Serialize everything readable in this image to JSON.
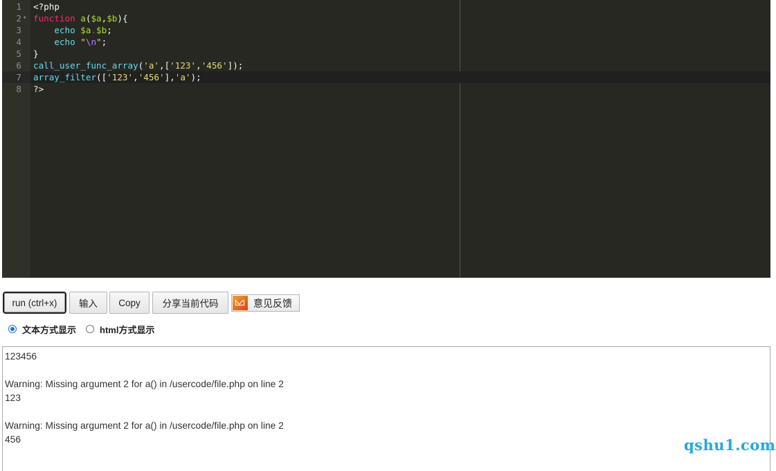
{
  "editor": {
    "line_numbers": [
      "1",
      "2",
      "3",
      "4",
      "5",
      "6",
      "7",
      "8"
    ],
    "fold_marker": "▾",
    "lines": {
      "l1": {
        "open": "<?php"
      },
      "l2": {
        "kw": "function",
        "fname": " a",
        "p1": "(",
        "v1": "$a",
        "comma": ",",
        "v2": "$b",
        "p2": "){"
      },
      "l3": {
        "indent": "    ",
        "echo": "echo",
        "sp": " ",
        "v1": "$a",
        "dot": ".",
        "v2": "$b",
        "semi": ";"
      },
      "l4": {
        "indent": "    ",
        "echo": "echo",
        "sp": " ",
        "q1": "\"",
        "esc": "\\n",
        "q2": "\"",
        "semi": ";"
      },
      "l5": {
        "brace": "}"
      },
      "l6": {
        "fn": "call_user_func_array",
        "p1": "(",
        "s1": "'a'",
        "c1": ",[",
        "s2": "'123'",
        "c2": ",",
        "s3": "'456'",
        "p2": "]);"
      },
      "l7": {
        "fn": "array_filter",
        "p1": "([",
        "s1": "'123'",
        "c1": ",",
        "s2": "'456'",
        "c2": "],",
        "s3": "'a'",
        "p2": ");"
      },
      "l8": {
        "close": "?>"
      }
    }
  },
  "toolbar": {
    "run_label": "run (ctrl+x)",
    "input_label": "输入",
    "copy_label": "Copy",
    "share_label": "分享当前代码",
    "feedback_label": "意见反馈",
    "feedback_icon": "mail-icon"
  },
  "display_mode": {
    "text_label": "文本方式显示",
    "html_label": "html方式显示",
    "selected": "text"
  },
  "output": {
    "lines": [
      "123456",
      "",
      "Warning: Missing argument 2 for a() in /usercode/file.php on line 2",
      "123",
      "",
      "Warning: Missing argument 2 for a() in /usercode/file.php on line 2",
      "456"
    ]
  },
  "watermark": "qshu1.com",
  "colors": {
    "editor_bg": "#272822",
    "keyword": "#f92672",
    "function": "#a6e22e",
    "string": "#e6db74",
    "builtin": "#66d9ef",
    "escape": "#ae81ff",
    "watermark": "#25a9d8"
  }
}
